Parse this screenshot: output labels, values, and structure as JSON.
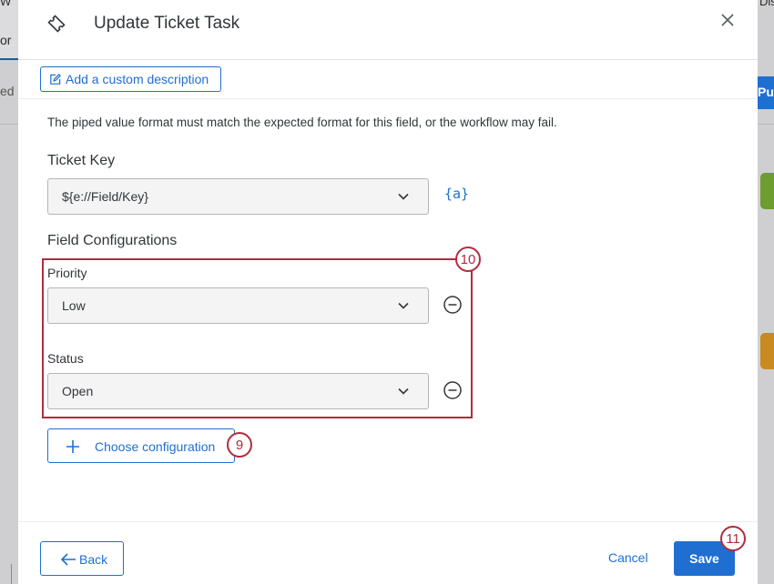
{
  "background": {
    "left_text_top": "W",
    "left_tab_text": "or",
    "left_status_text": "ed",
    "right_text_top": "Dis",
    "right_button_text": "Pu"
  },
  "modal": {
    "title": "Update Ticket Task",
    "title_icon": "ticket-icon",
    "close_icon": "close-icon",
    "custom_description_label": "Add a custom description",
    "info_text": "The piped value format must match the expected format for this field, or the workflow may fail.",
    "ticket_key": {
      "label": "Ticket Key",
      "value": "${e://Field/Key}",
      "piped_text_label": "{a}"
    },
    "field_configurations": {
      "label": "Field Configurations",
      "items": [
        {
          "label": "Priority",
          "value": "Low"
        },
        {
          "label": "Status",
          "value": "Open"
        }
      ],
      "choose_label": "Choose configuration"
    },
    "callouts": {
      "config_box": "10",
      "choose": "9",
      "save": "11"
    },
    "footer": {
      "back_label": "Back",
      "cancel_label": "Cancel",
      "save_label": "Save"
    }
  },
  "colors": {
    "accent": "#1f6fd1",
    "callout": "#b32b3c"
  }
}
